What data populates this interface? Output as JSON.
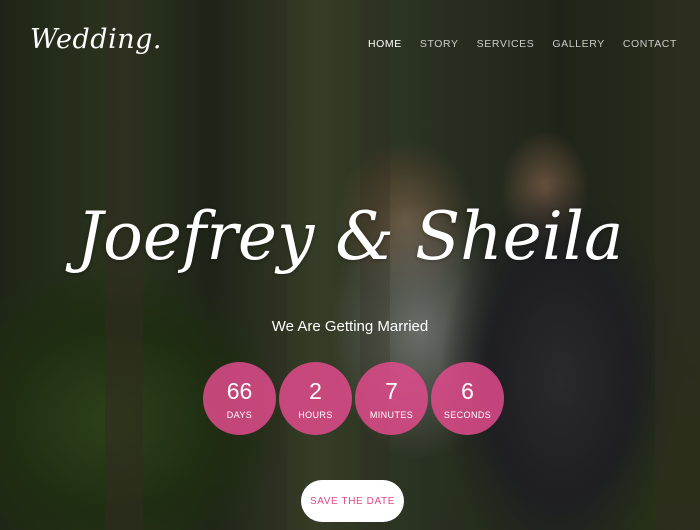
{
  "logo": "Wedding.",
  "nav": {
    "items": [
      {
        "label": "HOME",
        "active": true
      },
      {
        "label": "STORY",
        "active": false
      },
      {
        "label": "SERVICES",
        "active": false
      },
      {
        "label": "GALLERY",
        "active": false
      },
      {
        "label": "CONTACT",
        "active": false
      }
    ]
  },
  "hero": {
    "title": "Joefrey & Sheila",
    "subtitle": "We Are Getting Married",
    "countdown": [
      {
        "value": "66",
        "label": "DAYS"
      },
      {
        "value": "2",
        "label": "HOURS"
      },
      {
        "value": "7",
        "label": "MINUTES"
      },
      {
        "value": "6",
        "label": "SECONDS"
      }
    ],
    "cta": "SAVE THE DATE"
  },
  "colors": {
    "accent": "#e0478b",
    "text": "#ffffff"
  }
}
